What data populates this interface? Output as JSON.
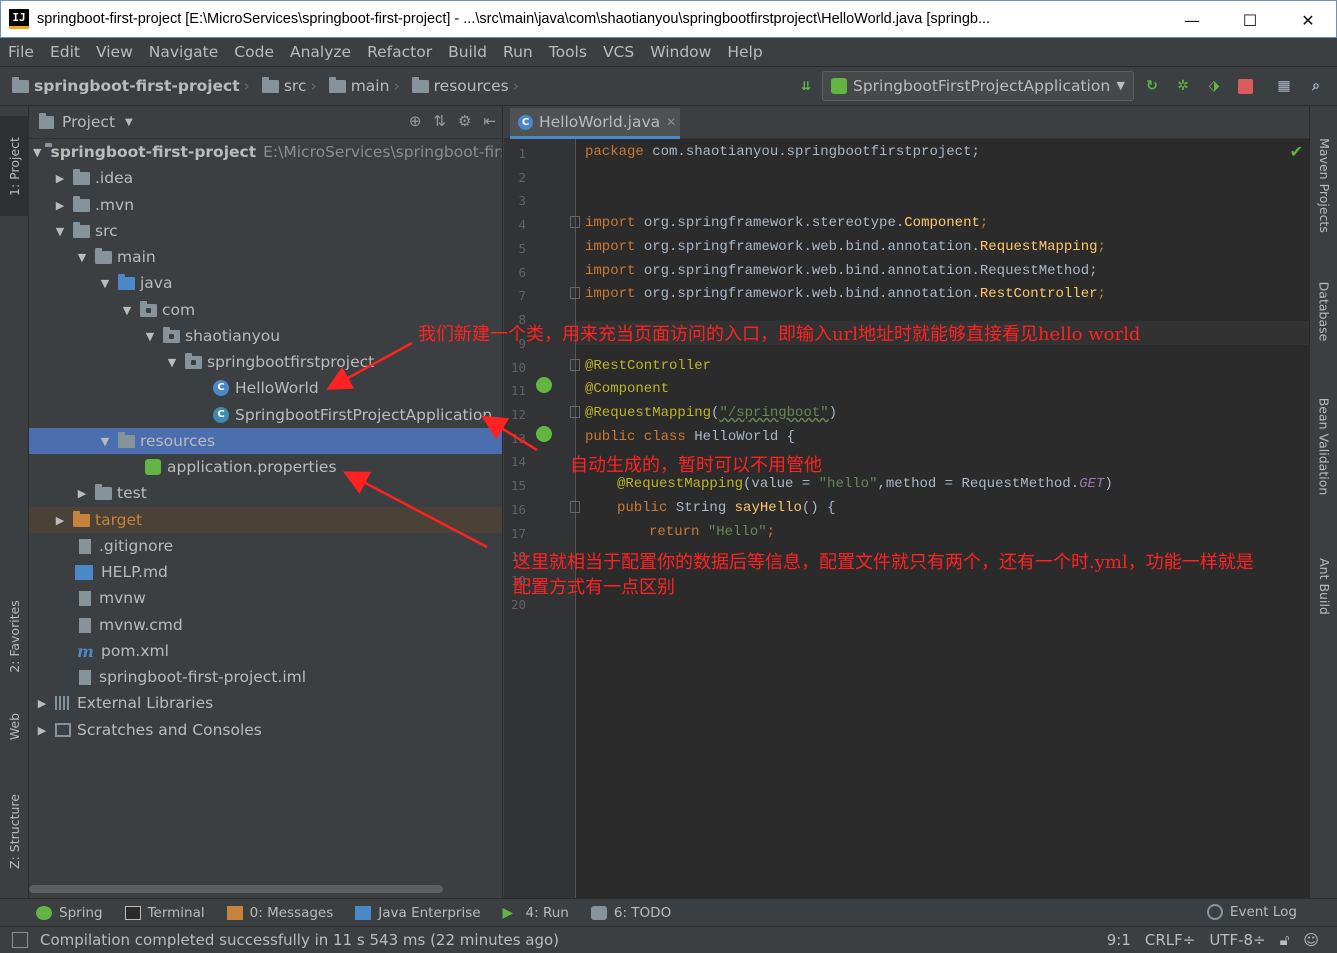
{
  "window": {
    "title": "springboot-first-project [E:\\MicroServices\\springboot-first-project] - ...\\src\\main\\java\\com\\shaotianyou\\springbootfirstproject\\HelloWorld.java [springb...",
    "minimize": "—",
    "maximize": "☐",
    "close": "✕"
  },
  "menu": [
    {
      "label": "File"
    },
    {
      "label": "Edit"
    },
    {
      "label": "View"
    },
    {
      "label": "Navigate"
    },
    {
      "label": "Code"
    },
    {
      "label": "Analyze"
    },
    {
      "label": "Refactor"
    },
    {
      "label": "Build"
    },
    {
      "label": "Run"
    },
    {
      "label": "Tools"
    },
    {
      "label": "VCS"
    },
    {
      "label": "Window"
    },
    {
      "label": "Help"
    }
  ],
  "breadcrumb": {
    "project": "springboot-first-project",
    "src": "src",
    "main": "main",
    "resources": "resources"
  },
  "run_config": "SpringbootFirstProjectApplication",
  "left_tabs": {
    "project": "1: Project",
    "favorites": "2: Favorites",
    "web": "Web",
    "structure": "Z: Structure"
  },
  "right_tabs": {
    "maven": "Maven Projects",
    "database": "Database",
    "bean": "Bean Validation",
    "ant": "Ant Build"
  },
  "project_panel": {
    "title": "Project",
    "tree": [
      {
        "label": "springboot-first-project",
        "extra": "E:\\MicroServices\\springboot-first"
      },
      {
        "label": ".idea"
      },
      {
        "label": ".mvn"
      },
      {
        "label": "src"
      },
      {
        "label": "main"
      },
      {
        "label": "java"
      },
      {
        "label": "com"
      },
      {
        "label": "shaotianyou"
      },
      {
        "label": "springbootfirstproject"
      },
      {
        "label": "HelloWorld"
      },
      {
        "label": "SpringbootFirstProjectApplication"
      },
      {
        "label": "resources"
      },
      {
        "label": "application.properties"
      },
      {
        "label": "test"
      },
      {
        "label": "target"
      },
      {
        "label": ".gitignore"
      },
      {
        "label": "HELP.md"
      },
      {
        "label": "mvnw"
      },
      {
        "label": "mvnw.cmd"
      },
      {
        "label": "pom.xml"
      },
      {
        "label": "springboot-first-project.iml"
      },
      {
        "label": "External Libraries"
      },
      {
        "label": "Scratches and Consoles"
      }
    ]
  },
  "editor": {
    "tab": "HelloWorld.java",
    "lines": [
      "1",
      "2",
      "3",
      "4",
      "5",
      "6",
      "7",
      "8",
      "9",
      "10",
      "11",
      "12",
      "13",
      "14",
      "15",
      "16",
      "17",
      "18",
      "19",
      "20"
    ],
    "code": {
      "l1_kw": "package",
      "l1_rest": " com.shaotianyou.springbootfirstproject;",
      "import": "import",
      "l4_pkg": " org.springframework.stereotype.",
      "l4_cls": "Component",
      "l4_end": ";",
      "l5_pkg": " org.springframework.web.bind.annotation.",
      "l5_cls": "RequestMapping",
      "l5_end": ";",
      "l6_rest": " org.springframework.web.bind.annotation.RequestMethod;",
      "l7_pkg": " org.springframework.web.bind.annotation.",
      "l7_cls": "RestController",
      "l7_end": ";",
      "l10": "@RestController",
      "l11": "@Component",
      "l12_ann": "@RequestMapping",
      "l12_open": "(",
      "l12_str": "\"/springboot\"",
      "l12_close": ")",
      "l13_kw": "public class",
      "l13_rest": " HelloWorld {",
      "l15_ann": "@RequestMapping",
      "l15_a": "(value = ",
      "l15_str": "\"hello\"",
      "l15_b": ",method = RequestMethod.",
      "l15_get": "GET",
      "l15_c": ")",
      "l16_kw": "public",
      "l16_a": " String ",
      "l16_fn": "sayHello",
      "l16_b": "() {",
      "l17_kw": "return",
      "l17_str": " \"Hello\"",
      "l17_end": ";"
    }
  },
  "annotations": {
    "a1": "我们新建一个类，用来充当页面访问的入口，即输入url地址时就能够直接看见hello world",
    "a2": "自动生成的，暂时可以不用管他",
    "a3_line1": "这里就相当于配置你的数据后等信息，配置文件就只有两个，还有一个时.yml，功能一样就是",
    "a3_line2": "配置方式有一点区别"
  },
  "bottom_tools": {
    "spring": "Spring",
    "terminal": "Terminal",
    "messages": "0: Messages",
    "java_enterprise": "Java Enterprise",
    "run": "4: Run",
    "todo": "6: TODO",
    "event_log": "Event Log"
  },
  "status": {
    "message": "Compilation completed successfully in 11 s 543 ms (22 minutes ago)",
    "position": "9:1",
    "line_sep": "CRLF÷",
    "encoding": "UTF-8÷"
  },
  "colors": {
    "accent": "#4a88c7",
    "selection": "#4b6eaf",
    "annotation": "#ff2222"
  }
}
